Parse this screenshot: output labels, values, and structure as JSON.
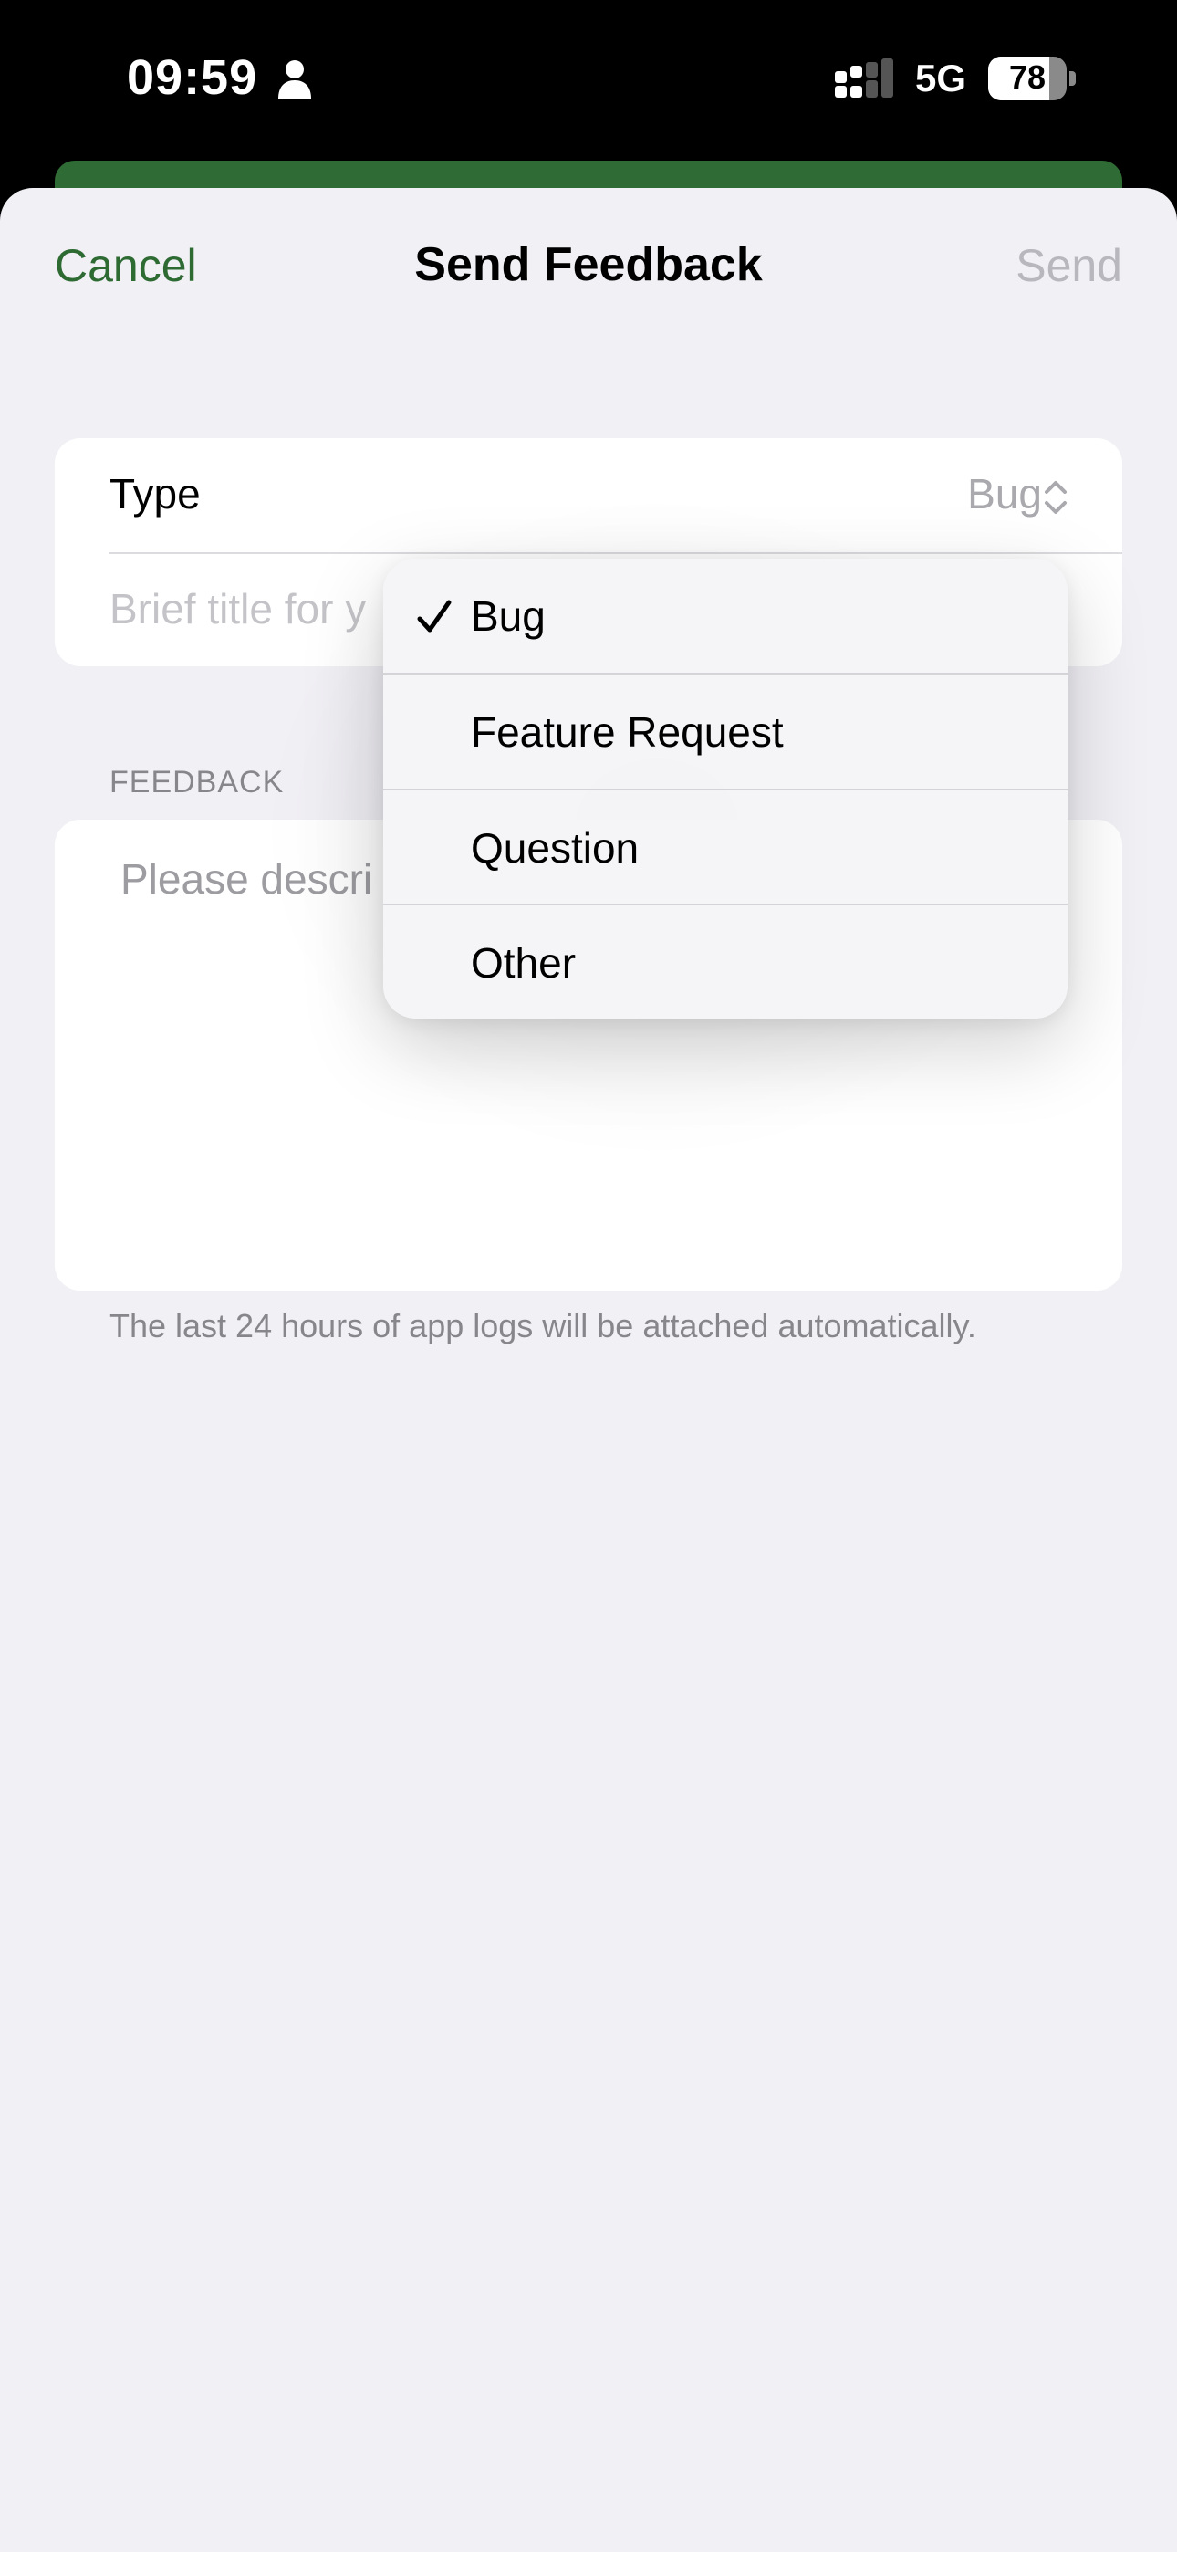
{
  "status_bar": {
    "time": "09:59",
    "network": "5G",
    "battery_percent": "78",
    "battery_level": 0.78,
    "icons": [
      "person-icon",
      "signal-icon",
      "battery-icon"
    ]
  },
  "nav": {
    "cancel_label": "Cancel",
    "title": "Send Feedback",
    "send_label": "Send"
  },
  "form": {
    "type_label": "Type",
    "type_value": "Bug",
    "title_placeholder": "Brief title for y",
    "feedback_header": "FEEDBACK",
    "feedback_placeholder": "Please descri",
    "footer_note": "The last 24 hours of app logs will be attached automatically."
  },
  "type_menu": {
    "selected": "Bug",
    "items": [
      {
        "label": "Bug",
        "checked": true
      },
      {
        "label": "Feature Request",
        "checked": false
      },
      {
        "label": "Question",
        "checked": false
      },
      {
        "label": "Other",
        "checked": false
      }
    ]
  },
  "colors": {
    "accent": "#2e6b33",
    "background": "#f1f0f5",
    "disabled": "#b7b7bd",
    "secondary_text": "#86868b"
  }
}
